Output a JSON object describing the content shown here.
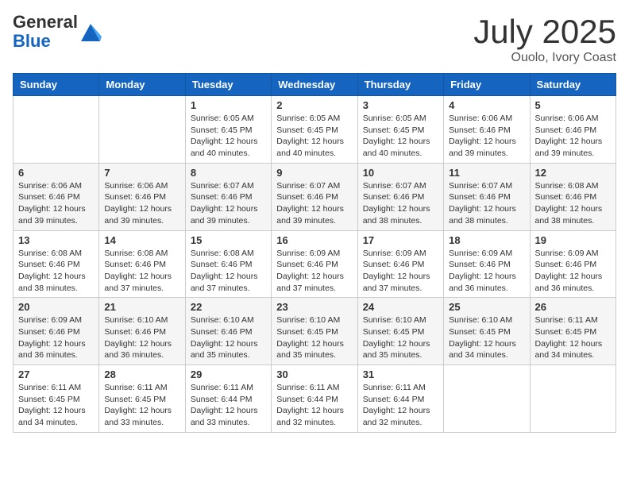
{
  "logo": {
    "general": "General",
    "blue": "Blue"
  },
  "header": {
    "month": "July 2025",
    "location": "Ouolo, Ivory Coast"
  },
  "weekdays": [
    "Sunday",
    "Monday",
    "Tuesday",
    "Wednesday",
    "Thursday",
    "Friday",
    "Saturday"
  ],
  "weeks": [
    [
      {
        "day": "",
        "info": ""
      },
      {
        "day": "",
        "info": ""
      },
      {
        "day": "1",
        "info": "Sunrise: 6:05 AM\nSunset: 6:45 PM\nDaylight: 12 hours and 40 minutes."
      },
      {
        "day": "2",
        "info": "Sunrise: 6:05 AM\nSunset: 6:45 PM\nDaylight: 12 hours and 40 minutes."
      },
      {
        "day": "3",
        "info": "Sunrise: 6:05 AM\nSunset: 6:45 PM\nDaylight: 12 hours and 40 minutes."
      },
      {
        "day": "4",
        "info": "Sunrise: 6:06 AM\nSunset: 6:46 PM\nDaylight: 12 hours and 39 minutes."
      },
      {
        "day": "5",
        "info": "Sunrise: 6:06 AM\nSunset: 6:46 PM\nDaylight: 12 hours and 39 minutes."
      }
    ],
    [
      {
        "day": "6",
        "info": "Sunrise: 6:06 AM\nSunset: 6:46 PM\nDaylight: 12 hours and 39 minutes."
      },
      {
        "day": "7",
        "info": "Sunrise: 6:06 AM\nSunset: 6:46 PM\nDaylight: 12 hours and 39 minutes."
      },
      {
        "day": "8",
        "info": "Sunrise: 6:07 AM\nSunset: 6:46 PM\nDaylight: 12 hours and 39 minutes."
      },
      {
        "day": "9",
        "info": "Sunrise: 6:07 AM\nSunset: 6:46 PM\nDaylight: 12 hours and 39 minutes."
      },
      {
        "day": "10",
        "info": "Sunrise: 6:07 AM\nSunset: 6:46 PM\nDaylight: 12 hours and 38 minutes."
      },
      {
        "day": "11",
        "info": "Sunrise: 6:07 AM\nSunset: 6:46 PM\nDaylight: 12 hours and 38 minutes."
      },
      {
        "day": "12",
        "info": "Sunrise: 6:08 AM\nSunset: 6:46 PM\nDaylight: 12 hours and 38 minutes."
      }
    ],
    [
      {
        "day": "13",
        "info": "Sunrise: 6:08 AM\nSunset: 6:46 PM\nDaylight: 12 hours and 38 minutes."
      },
      {
        "day": "14",
        "info": "Sunrise: 6:08 AM\nSunset: 6:46 PM\nDaylight: 12 hours and 37 minutes."
      },
      {
        "day": "15",
        "info": "Sunrise: 6:08 AM\nSunset: 6:46 PM\nDaylight: 12 hours and 37 minutes."
      },
      {
        "day": "16",
        "info": "Sunrise: 6:09 AM\nSunset: 6:46 PM\nDaylight: 12 hours and 37 minutes."
      },
      {
        "day": "17",
        "info": "Sunrise: 6:09 AM\nSunset: 6:46 PM\nDaylight: 12 hours and 37 minutes."
      },
      {
        "day": "18",
        "info": "Sunrise: 6:09 AM\nSunset: 6:46 PM\nDaylight: 12 hours and 36 minutes."
      },
      {
        "day": "19",
        "info": "Sunrise: 6:09 AM\nSunset: 6:46 PM\nDaylight: 12 hours and 36 minutes."
      }
    ],
    [
      {
        "day": "20",
        "info": "Sunrise: 6:09 AM\nSunset: 6:46 PM\nDaylight: 12 hours and 36 minutes."
      },
      {
        "day": "21",
        "info": "Sunrise: 6:10 AM\nSunset: 6:46 PM\nDaylight: 12 hours and 36 minutes."
      },
      {
        "day": "22",
        "info": "Sunrise: 6:10 AM\nSunset: 6:46 PM\nDaylight: 12 hours and 35 minutes."
      },
      {
        "day": "23",
        "info": "Sunrise: 6:10 AM\nSunset: 6:45 PM\nDaylight: 12 hours and 35 minutes."
      },
      {
        "day": "24",
        "info": "Sunrise: 6:10 AM\nSunset: 6:45 PM\nDaylight: 12 hours and 35 minutes."
      },
      {
        "day": "25",
        "info": "Sunrise: 6:10 AM\nSunset: 6:45 PM\nDaylight: 12 hours and 34 minutes."
      },
      {
        "day": "26",
        "info": "Sunrise: 6:11 AM\nSunset: 6:45 PM\nDaylight: 12 hours and 34 minutes."
      }
    ],
    [
      {
        "day": "27",
        "info": "Sunrise: 6:11 AM\nSunset: 6:45 PM\nDaylight: 12 hours and 34 minutes."
      },
      {
        "day": "28",
        "info": "Sunrise: 6:11 AM\nSunset: 6:45 PM\nDaylight: 12 hours and 33 minutes."
      },
      {
        "day": "29",
        "info": "Sunrise: 6:11 AM\nSunset: 6:44 PM\nDaylight: 12 hours and 33 minutes."
      },
      {
        "day": "30",
        "info": "Sunrise: 6:11 AM\nSunset: 6:44 PM\nDaylight: 12 hours and 32 minutes."
      },
      {
        "day": "31",
        "info": "Sunrise: 6:11 AM\nSunset: 6:44 PM\nDaylight: 12 hours and 32 minutes."
      },
      {
        "day": "",
        "info": ""
      },
      {
        "day": "",
        "info": ""
      }
    ]
  ]
}
